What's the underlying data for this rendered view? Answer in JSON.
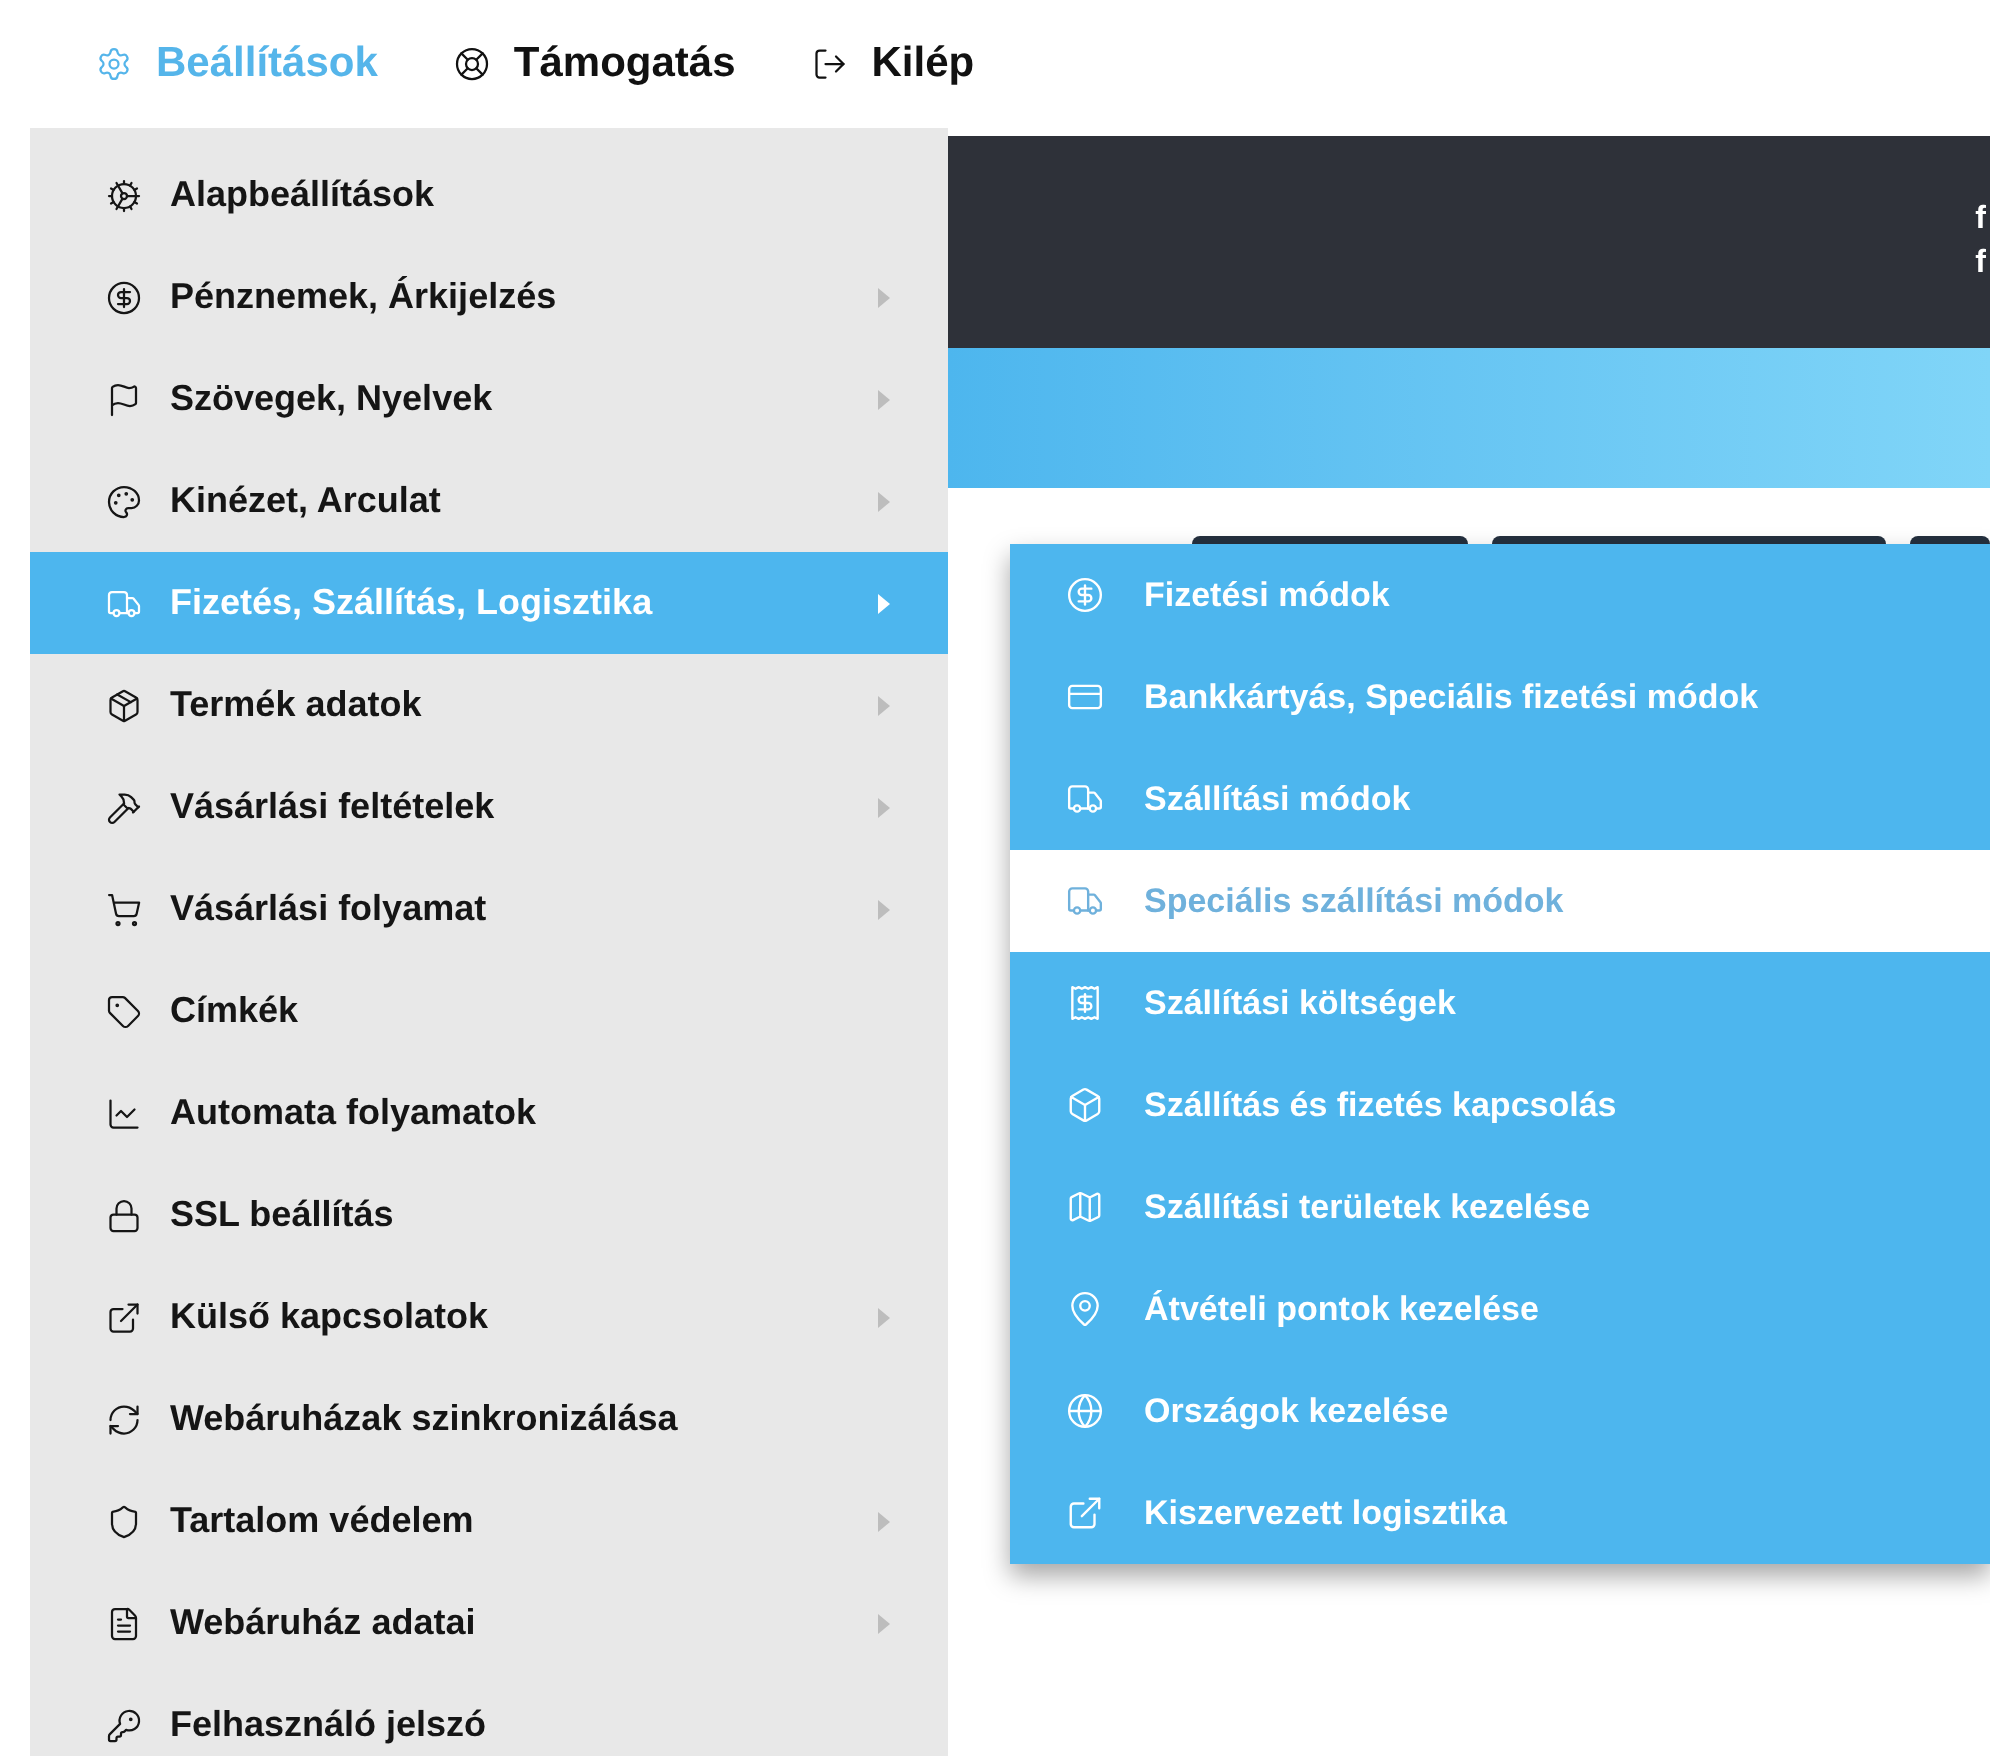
{
  "nav": [
    {
      "label": "Beállítások",
      "selected": true
    },
    {
      "label": "Támogatás",
      "selected": false
    },
    {
      "label": "Kilép",
      "selected": false
    }
  ],
  "banner_lines": [
    "f",
    "f"
  ],
  "menu": [
    {
      "label": "Alapbeállítások",
      "has_submenu": false,
      "selected": false
    },
    {
      "label": "Pénznemek, Árkijelzés",
      "has_submenu": true,
      "selected": false
    },
    {
      "label": "Szövegek, Nyelvek",
      "has_submenu": true,
      "selected": false
    },
    {
      "label": "Kinézet, Arculat",
      "has_submenu": true,
      "selected": false
    },
    {
      "label": "Fizetés, Szállítás, Logisztika",
      "has_submenu": true,
      "selected": true
    },
    {
      "label": "Termék adatok",
      "has_submenu": true,
      "selected": false
    },
    {
      "label": "Vásárlási feltételek",
      "has_submenu": true,
      "selected": false
    },
    {
      "label": "Vásárlási folyamat",
      "has_submenu": true,
      "selected": false
    },
    {
      "label": "Címkék",
      "has_submenu": false,
      "selected": false
    },
    {
      "label": "Automata folyamatok",
      "has_submenu": false,
      "selected": false
    },
    {
      "label": "SSL beállítás",
      "has_submenu": false,
      "selected": false
    },
    {
      "label": "Külső kapcsolatok",
      "has_submenu": true,
      "selected": false
    },
    {
      "label": "Webáruházak szinkronizálása",
      "has_submenu": false,
      "selected": false
    },
    {
      "label": "Tartalom védelem",
      "has_submenu": true,
      "selected": false
    },
    {
      "label": "Webáruház adatai",
      "has_submenu": true,
      "selected": false
    },
    {
      "label": "Felhasználó jelszó",
      "has_submenu": false,
      "selected": false
    }
  ],
  "submenu": [
    {
      "label": "Fizetési módok",
      "selected": false
    },
    {
      "label": "Bankkártyás, Speciális fizetési módok",
      "selected": false
    },
    {
      "label": "Szállítási módok",
      "selected": false
    },
    {
      "label": "Speciális szállítási módok",
      "selected": true
    },
    {
      "label": "Szállítási költségek",
      "selected": false
    },
    {
      "label": "Szállítás és fizetés kapcsolás",
      "selected": false
    },
    {
      "label": "Szállítási területek kezelése",
      "selected": false
    },
    {
      "label": "Átvételi pontok kezelése",
      "selected": false
    },
    {
      "label": "Országok kezelése",
      "selected": false
    },
    {
      "label": "Kiszervezett logisztika",
      "selected": false
    }
  ]
}
